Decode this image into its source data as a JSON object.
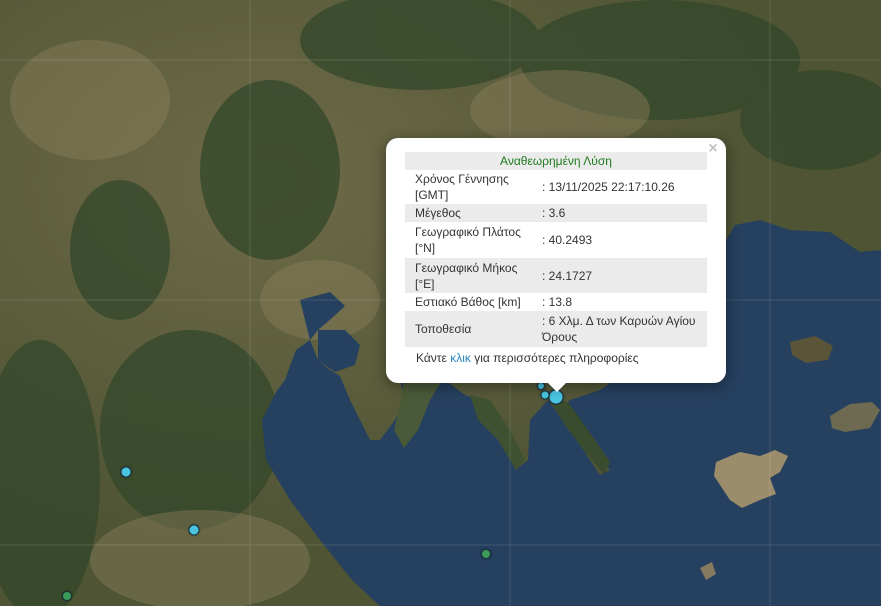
{
  "popup": {
    "title": "Αναθεωρημένη Λύση",
    "close_symbol": "×",
    "rows": [
      {
        "label": "Χρόνος Γέννησης [GMT]",
        "value": ": 13/11/2025 22:17:10.26"
      },
      {
        "label": "Μέγεθος",
        "value": ": 3.6"
      },
      {
        "label": "Γεωγραφικό Πλάτος [°N]",
        "value": ": 40.2493"
      },
      {
        "label": "Γεωγραφικό Μήκος [°E]",
        "value": ": 24.1727"
      },
      {
        "label": "Εστιακό Βάθος [km]",
        "value": ": 13.8"
      },
      {
        "label": "Τοποθεσία",
        "value": ": 6 Χλμ. Δ των Καρυών Αγίου Όρους"
      }
    ],
    "more": {
      "before": "Κάντε ",
      "link": "κλικ",
      "after": " για περισσότερες πληροφορίες"
    }
  },
  "colors": {
    "marker_cyan": "#4ac4df",
    "marker_green": "#3a9b5b",
    "sea": "#26405f",
    "land": "#5c5a3e",
    "title_text": "#1e7b1e",
    "link": "#2a85c0"
  }
}
